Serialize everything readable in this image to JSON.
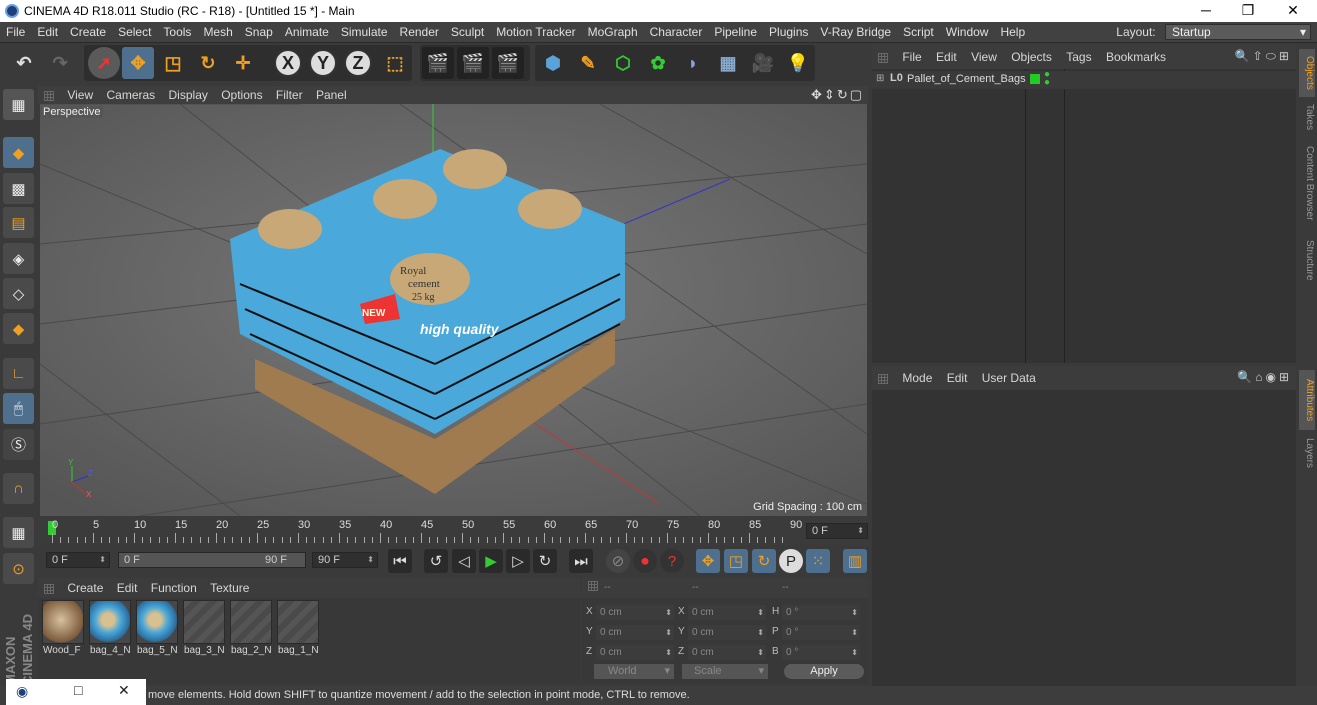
{
  "window": {
    "title": "CINEMA 4D R18.011 Studio (RC - R18) - [Untitled 15 *] - Main",
    "controls": [
      "minimize",
      "restore",
      "close"
    ]
  },
  "menubar": {
    "items": [
      "File",
      "Edit",
      "Create",
      "Select",
      "Tools",
      "Mesh",
      "Snap",
      "Animate",
      "Simulate",
      "Render",
      "Sculpt",
      "Motion Tracker",
      "MoGraph",
      "Character",
      "Pipeline",
      "Plugins",
      "V-Ray Bridge",
      "Script",
      "Window",
      "Help"
    ],
    "layout_label": "Layout:",
    "layout_value": "Startup"
  },
  "toolbar": {
    "icons": [
      "undo-icon",
      "redo-icon",
      "live-selection-icon",
      "move-icon",
      "scale-icon",
      "rotate-icon",
      "recent-tool-icon",
      "x-axis-icon",
      "y-axis-icon",
      "z-axis-icon",
      "world-coordinates-icon",
      "render-view-icon",
      "render-picture-viewer-icon",
      "render-settings-icon",
      "cube-icon",
      "pen-icon",
      "subdivision-icon",
      "cloner-icon",
      "deformer-icon",
      "floor-icon",
      "camera-icon",
      "light-icon"
    ],
    "axis_labels": [
      "X",
      "Y",
      "Z"
    ]
  },
  "left_tools": [
    "make-editable-icon",
    "model-mode-icon",
    "texture-mode-icon",
    "workplane-icon",
    "points-mode-icon",
    "edges-mode-icon",
    "polygons-mode-icon",
    "axis-mode-icon",
    "tweak-icon",
    "snap-icon",
    "magnet-icon",
    "lock-workplane-icon",
    "solo-icon"
  ],
  "viewport": {
    "menu": [
      "View",
      "Cameras",
      "Display",
      "Options",
      "Filter",
      "Panel"
    ],
    "camera_label": "Perspective",
    "grid_spacing": "Grid Spacing : 100 cm",
    "axis_labels": {
      "y": "Y",
      "z": "Z",
      "x": "X"
    },
    "bag_texts": [
      "Royal",
      "cement",
      "25 kg",
      "high quality",
      "NEW"
    ]
  },
  "timeline": {
    "ticks": [
      "0",
      "5",
      "10",
      "15",
      "20",
      "25",
      "30",
      "35",
      "40",
      "45",
      "50",
      "55",
      "60",
      "65",
      "70",
      "75",
      "80",
      "85",
      "90"
    ],
    "current_frame": "0 F"
  },
  "playbar": {
    "start_field": "0 F",
    "range_start": "0 F",
    "range_end": "90 F",
    "end_field": "90 F"
  },
  "material_panel": {
    "menu": [
      "Create",
      "Edit",
      "Function",
      "Texture"
    ],
    "materials": [
      {
        "label": "Wood_F",
        "type": "wood"
      },
      {
        "label": "bag_4_N",
        "type": "bag"
      },
      {
        "label": "bag_5_N",
        "type": "bag"
      },
      {
        "label": "bag_3_N",
        "type": "empty"
      },
      {
        "label": "bag_2_N",
        "type": "empty"
      },
      {
        "label": "bag_1_N",
        "type": "empty"
      }
    ]
  },
  "coord_panel": {
    "headers": [
      "--",
      "--",
      "--"
    ],
    "rows": [
      {
        "l1": "X",
        "v1": "0 cm",
        "l2": "X",
        "v2": "0 cm",
        "l3": "H",
        "v3": "0 °"
      },
      {
        "l1": "Y",
        "v1": "0 cm",
        "l2": "Y",
        "v2": "0 cm",
        "l3": "P",
        "v3": "0 °"
      },
      {
        "l1": "Z",
        "v1": "0 cm",
        "l2": "Z",
        "v2": "0 cm",
        "l3": "B",
        "v3": "0 °"
      }
    ],
    "coord_mode": "World",
    "size_mode": "Scale",
    "apply_label": "Apply"
  },
  "object_manager": {
    "menu": [
      "File",
      "Edit",
      "View",
      "Objects",
      "Tags",
      "Bookmarks"
    ],
    "objects": [
      {
        "name": "Pallet_of_Cement_Bags",
        "layer_color": "#22cc22"
      }
    ]
  },
  "attribute_manager": {
    "menu": [
      "Mode",
      "Edit",
      "User Data"
    ]
  },
  "right_tabs": [
    "Objects",
    "Takes",
    "Content Browser",
    "Structure",
    "Attributes",
    "Layers"
  ],
  "status": {
    "text": "move elements. Hold down SHIFT to quantize movement / add to the selection in point mode, CTRL to remove."
  },
  "branding": "MAXON CINEMA 4D",
  "colors": {
    "accent": "#f0a020",
    "highlight_blue": "#5aa3d8",
    "selected_orange": "#e8a33d"
  }
}
